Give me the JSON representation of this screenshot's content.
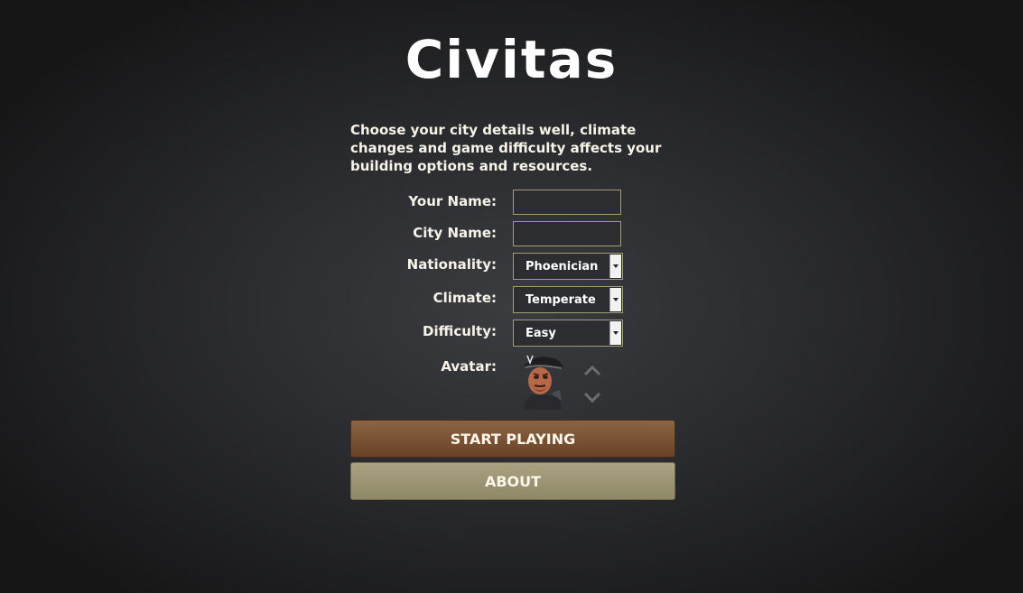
{
  "title": "Civitas",
  "intro": "Choose your city details well, climate changes and game difficulty affects your building options and resources.",
  "form": {
    "name_label": "Your Name:",
    "name_value": "",
    "city_label": "City Name:",
    "city_value": "",
    "nationality_label": "Nationality:",
    "nationality_value": "Phoenician",
    "climate_label": "Climate:",
    "climate_value": "Temperate",
    "difficulty_label": "Difficulty:",
    "difficulty_value": "Easy",
    "avatar_label": "Avatar:"
  },
  "icons": {
    "avatar": "pirate-captain-avatar",
    "up": "chevron-up-icon",
    "down": "chevron-down-icon",
    "dropdown": "dropdown-arrow-icon"
  },
  "buttons": {
    "start": "START PLAYING",
    "about": "ABOUT"
  },
  "colors": {
    "start_button": "#7a5536",
    "about_button": "#9d9674",
    "input_border": "#a49c77"
  }
}
